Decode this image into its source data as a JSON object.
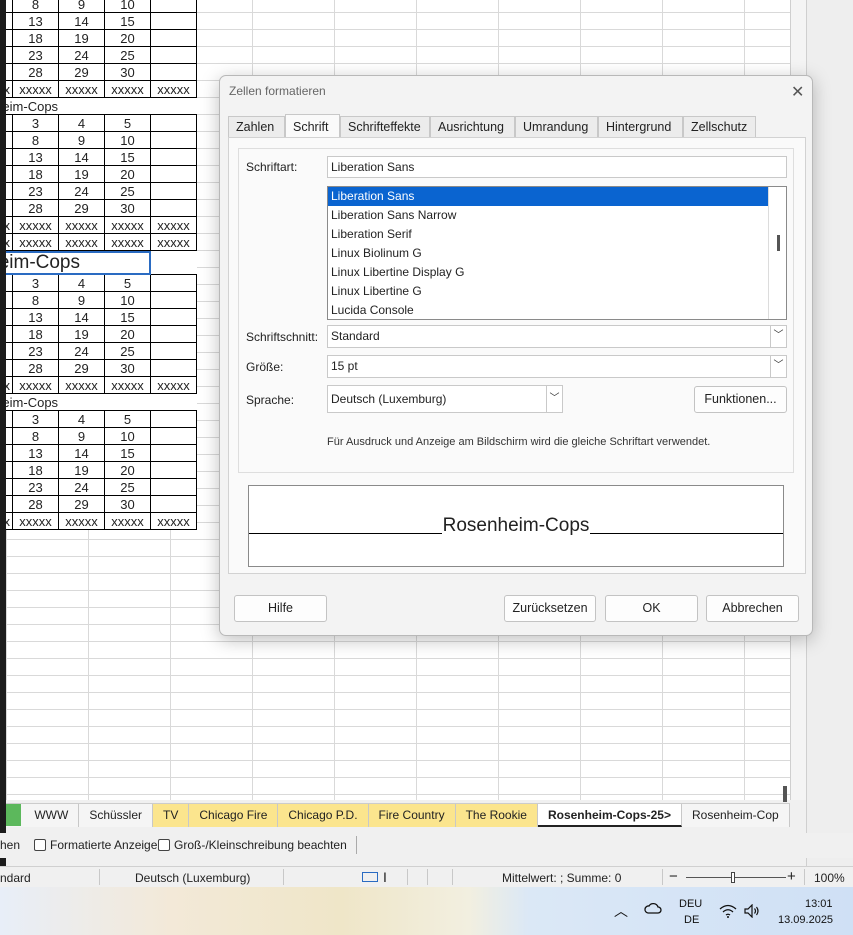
{
  "sheet": {
    "rows": [
      [
        "",
        "8",
        "9",
        "10",
        ""
      ],
      [
        "",
        "13",
        "14",
        "15",
        ""
      ],
      [
        "",
        "18",
        "19",
        "20",
        ""
      ],
      [
        "",
        "23",
        "24",
        "25",
        ""
      ],
      [
        "",
        "28",
        "29",
        "30",
        ""
      ],
      [
        "x",
        "xxxxx",
        "xxxxx",
        "xxxxx",
        "xxxxx"
      ],
      [
        "TITLE:osenheim-Cops"
      ],
      [
        "",
        "3",
        "4",
        "5",
        ""
      ],
      [
        "",
        "8",
        "9",
        "10",
        ""
      ],
      [
        "",
        "13",
        "14",
        "15",
        ""
      ],
      [
        "",
        "18",
        "19",
        "20",
        ""
      ],
      [
        "",
        "23",
        "24",
        "25",
        ""
      ],
      [
        "",
        "28",
        "29",
        "30",
        ""
      ],
      [
        "x",
        "xxxxx",
        "xxxxx",
        "xxxxx",
        "xxxxx"
      ],
      [
        "x",
        "xxxxx",
        "xxxxx",
        "xxxxx",
        "xxxxx"
      ],
      [
        "BIG:enheim-Cops"
      ],
      [
        "",
        "3",
        "4",
        "5",
        ""
      ],
      [
        "",
        "8",
        "9",
        "10",
        ""
      ],
      [
        "",
        "13",
        "14",
        "15",
        ""
      ],
      [
        "",
        "18",
        "19",
        "20",
        ""
      ],
      [
        "",
        "23",
        "24",
        "25",
        ""
      ],
      [
        "",
        "28",
        "29",
        "30",
        ""
      ],
      [
        "x",
        "xxxxx",
        "xxxxx",
        "xxxxx",
        "xxxxx"
      ],
      [
        "TITLE:osenheim-Cops"
      ],
      [
        "",
        "3",
        "4",
        "5",
        ""
      ],
      [
        "",
        "8",
        "9",
        "10",
        ""
      ],
      [
        "",
        "13",
        "14",
        "15",
        ""
      ],
      [
        "",
        "18",
        "19",
        "20",
        ""
      ],
      [
        "",
        "23",
        "24",
        "25",
        ""
      ],
      [
        "",
        "28",
        "29",
        "30",
        ""
      ],
      [
        "x",
        "xxxxx",
        "xxxxx",
        "xxxxx",
        "xxxxx"
      ]
    ],
    "tabs": [
      "WWW",
      "Schüssler",
      "TV",
      "Chicago Fire",
      "Chicago P.D.",
      "Fire Country",
      "The Rookie",
      "Rosenheim-Cops-25>",
      "Rosenheim-Cop"
    ],
    "tab_colors": {
      "yellow": "#fbe58e",
      "green": "#5cb85c"
    }
  },
  "dialog": {
    "title": "Zellen formatieren",
    "tabs": [
      "Zahlen",
      "Schrift",
      "Schrifteffekte",
      "Ausrichtung",
      "Umrandung",
      "Hintergrund",
      "Zellschutz"
    ],
    "active_tab": "Schrift",
    "font_label": "Schriftart:",
    "font_value": "Liberation Sans",
    "font_list": [
      "Liberation Sans",
      "Liberation Sans Narrow",
      "Liberation Serif",
      "Linux Biolinum G",
      "Linux Libertine Display G",
      "Linux Libertine G",
      "Lucida Console"
    ],
    "style_label": "Schriftschnitt:",
    "style_value": "Standard",
    "size_label": "Größe:",
    "size_value": "15 pt",
    "lang_label": "Sprache:",
    "lang_value": "Deutsch (Luxemburg)",
    "features_button": "Funktionen...",
    "note": "Für Ausdruck und Anzeige am Bildschirm wird die gleiche Schriftart verwendet.",
    "preview_text": "Rosenheim-Cops",
    "help_button": "Hilfe",
    "reset_button": "Zurücksetzen",
    "ok_button": "OK",
    "cancel_button": "Abbrechen",
    "selection_color": "#0a64d0"
  },
  "findbar": {
    "partial_label": "hen",
    "formatted_label": "Formatierte Anzeige",
    "case_label": "Groß-/Kleinschreibung beachten"
  },
  "statusbar": {
    "style": "ndard",
    "language": "Deutsch (Luxemburg)",
    "sum": "Mittelwert: ; Summe: 0",
    "zoom_minus": "−",
    "zoom_plus": "+",
    "zoom": "100%"
  },
  "taskbar": {
    "lang_top": "DEU",
    "lang_bottom": "DE",
    "time": "13:01",
    "date": "13.09.2025"
  }
}
